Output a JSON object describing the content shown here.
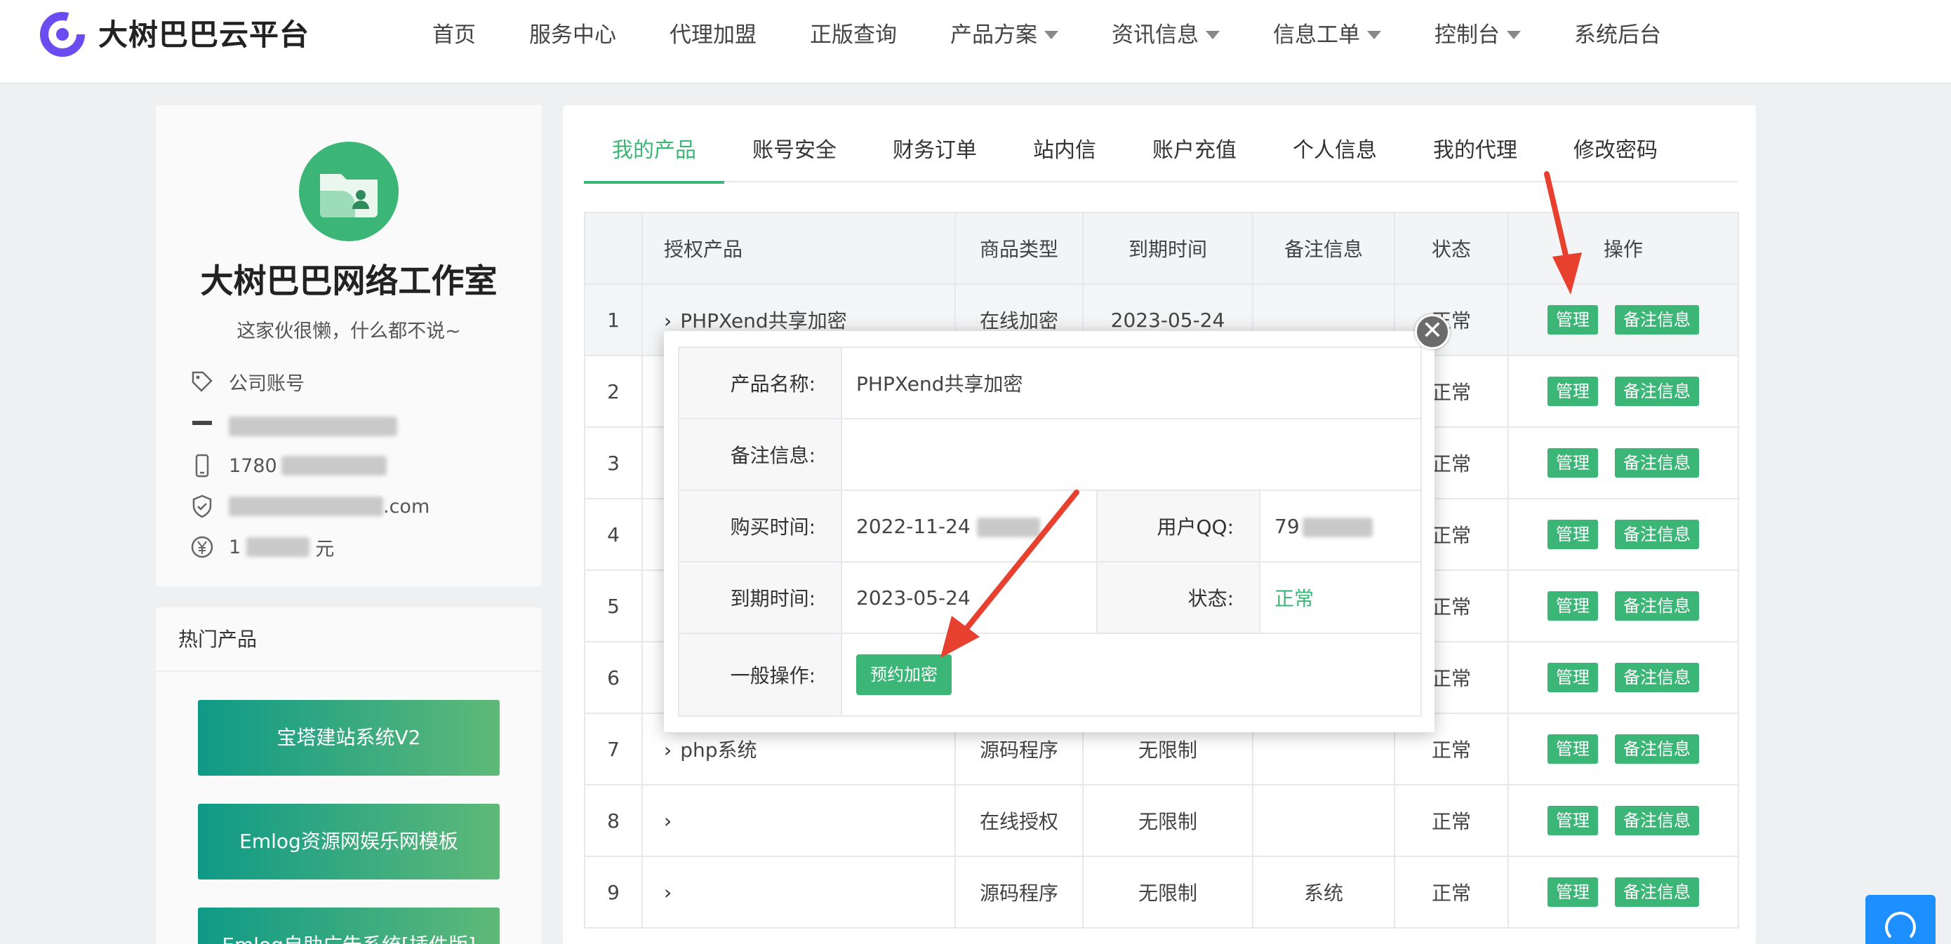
{
  "header": {
    "brand": "大树巴巴云平台",
    "nav": [
      {
        "label": "首页",
        "dropdown": false
      },
      {
        "label": "服务中心",
        "dropdown": false
      },
      {
        "label": "代理加盟",
        "dropdown": false
      },
      {
        "label": "正版查询",
        "dropdown": false
      },
      {
        "label": "产品方案",
        "dropdown": true
      },
      {
        "label": "资讯信息",
        "dropdown": true
      },
      {
        "label": "信息工单",
        "dropdown": true
      },
      {
        "label": "控制台",
        "dropdown": true
      },
      {
        "label": "系统后台",
        "dropdown": false
      }
    ]
  },
  "profile": {
    "company": "大树巴巴网络工作室",
    "motto": "这家伙很懒，什么都不说~",
    "account_type": "公司账号",
    "phone_prefix": "1780",
    "email_suffix": ".com",
    "balance_prefix": "1",
    "balance_suffix": "元"
  },
  "hot": {
    "title": "热门产品",
    "items": [
      "宝塔建站系统V2",
      "Emlog资源网娱乐网模板",
      "Emlog自助广告系统[插件版]"
    ]
  },
  "tabs": [
    "我的产品",
    "账号安全",
    "财务订单",
    "站内信",
    "账户充值",
    "个人信息",
    "我的代理",
    "修改密码"
  ],
  "table": {
    "headers": [
      "",
      "授权产品",
      "商品类型",
      "到期时间",
      "备注信息",
      "状态",
      "操作"
    ],
    "rows": [
      {
        "no": "1",
        "product": "PHPXend共享加密",
        "type": "在线加密",
        "expire": "2023-05-24",
        "note": "",
        "status": "正常"
      },
      {
        "no": "2",
        "product": "",
        "type": "",
        "expire": "",
        "note": "",
        "status": "正常"
      },
      {
        "no": "3",
        "product": "",
        "type": "",
        "expire": "",
        "note": "",
        "status": "正常"
      },
      {
        "no": "4",
        "product": "",
        "type": "",
        "expire": "",
        "note": "",
        "status": "正常"
      },
      {
        "no": "5",
        "product": "",
        "type": "",
        "expire": "",
        "note": "",
        "status": "正常"
      },
      {
        "no": "6",
        "product": "",
        "type": "",
        "expire": "",
        "note": "",
        "status": "正常"
      },
      {
        "no": "7",
        "product": "php系统",
        "type": "源码程序",
        "expire": "无限制",
        "note": "",
        "status": "正常"
      },
      {
        "no": "8",
        "product": "",
        "type": "在线授权",
        "expire": "无限制",
        "note": "",
        "status": "正常"
      },
      {
        "no": "9",
        "product": "",
        "type": "源码程序",
        "expire": "无限制",
        "note": "系统",
        "status": "正常"
      }
    ],
    "manage_label": "管理",
    "note_label": "备注信息"
  },
  "modal": {
    "product_label": "产品名称:",
    "product_value": "PHPXend共享加密",
    "note_label": "备注信息:",
    "note_value": "",
    "buy_label": "购买时间:",
    "buy_value": "2022-11-24",
    "qq_label": "用户QQ:",
    "qq_value": "79",
    "expire_label": "到期时间:",
    "expire_value": "2023-05-24",
    "status_label": "状态:",
    "status_value": "正常",
    "op_label": "一般操作:",
    "op_button": "预约加密",
    "close": "✕"
  },
  "colors": {
    "accent": "#3bb677",
    "brand_purple": "#6a4cf0",
    "arrow": "#e8402f",
    "float": "#1e8fff"
  }
}
